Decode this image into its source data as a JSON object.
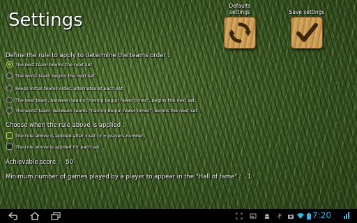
{
  "header": {
    "title": "Settings",
    "defaults_label": "Defaults settings",
    "save_label": "Save settings"
  },
  "order_rule": {
    "label": "Define the rule to apply to determine the teams order :",
    "options": [
      {
        "label": "The best team begins the next set.",
        "checked": true
      },
      {
        "label": "The worst team begins the next set.",
        "checked": false
      },
      {
        "label": "Keeps initial teams order, alternates at each set",
        "checked": false
      },
      {
        "label": "The best team, between teams \"having begun fewer times\", begins the next set.",
        "checked": false
      },
      {
        "label": "The worst team, between teams \"having begun fewer times\", begins the next set.",
        "checked": false
      }
    ]
  },
  "apply_rule": {
    "label": "Choose when the rule above is applied :",
    "options": [
      {
        "label": "The rule above is applied after x set (x = players number)",
        "checked": true
      },
      {
        "label": "The rule above is applied for each set.",
        "checked": false
      }
    ]
  },
  "score": {
    "label": "Achievable score :",
    "value": "50"
  },
  "min_games": {
    "label": "Minimum number of games played by a player to appear in the \"Hall of fame\" :",
    "value": "1"
  },
  "system_bar": {
    "time": "7:20",
    "nav_icons": [
      "back-icon",
      "home-icon",
      "recent-apps-icon"
    ],
    "status_icons": [
      "screenshot-icon",
      "image-icon",
      "android-icon",
      "usb-icon",
      "camera-icon",
      "wifi-icon",
      "battery-icon"
    ]
  }
}
